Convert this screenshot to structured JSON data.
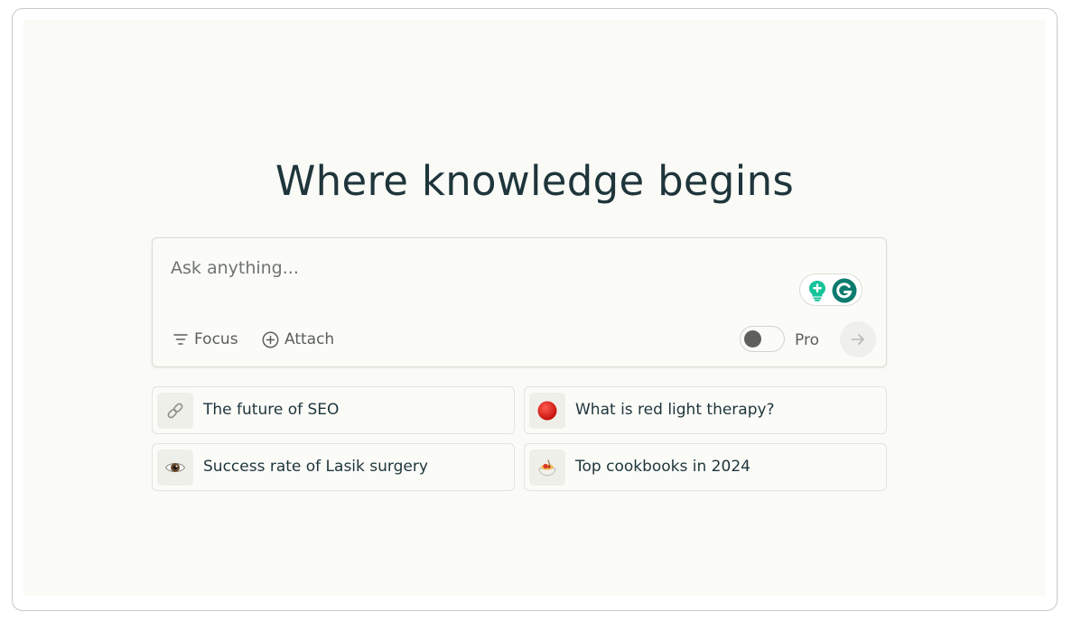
{
  "hero": {
    "title": "Where knowledge begins"
  },
  "search": {
    "placeholder": "Ask anything...",
    "value": "",
    "focus_label": "Focus",
    "attach_label": "Attach",
    "pro_label": "Pro",
    "pro_enabled": false
  },
  "suggestions": [
    {
      "label": "The future of SEO",
      "icon": "link-icon"
    },
    {
      "label": "What is red light therapy?",
      "icon": "red-circle-icon"
    },
    {
      "label": "Success rate of Lasik surgery",
      "icon": "eye-icon"
    },
    {
      "label": "Top cookbooks in 2024",
      "icon": "spaghetti-icon"
    }
  ],
  "colors": {
    "background": "#fafaf6",
    "title_text": "#1e353b",
    "muted_text": "#5b605f",
    "grammarly_green": "#15c39a",
    "grammarly_teal": "#0c7b6e"
  }
}
